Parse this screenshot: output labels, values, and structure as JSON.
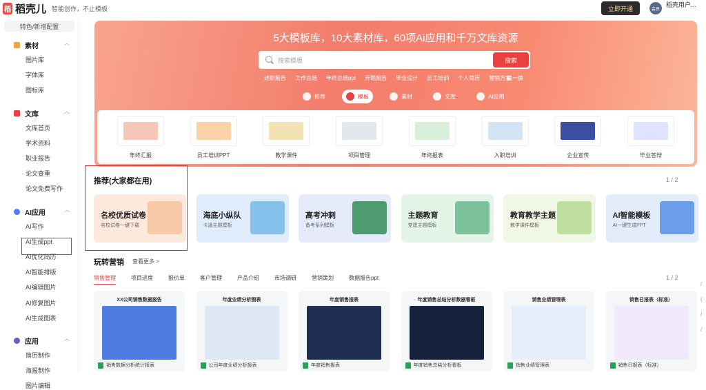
{
  "header": {
    "logo_glyph": "稻",
    "logo_text": "稻壳儿",
    "tagline": "智能创作，不止模板",
    "member_btn": "立即开通",
    "avatar_text": "会员",
    "username": "稻壳用户...",
    "user_sub": ""
  },
  "sidebar": {
    "top_button": "特色/新增配置",
    "groups": [
      {
        "label": "素材",
        "color": "#f0a23b",
        "items": [
          "图片库",
          "字体库",
          "图标库"
        ]
      },
      {
        "label": "文库",
        "color": "#e8413f",
        "items": [
          "文库首页",
          "学术资料",
          "职业报告",
          "论文查重",
          "论文免费写作"
        ]
      },
      {
        "label": "AI应用",
        "color": "#4a7dff",
        "items": [
          "AI写作",
          "AI生成ppt",
          "AI优化简历",
          "AI智能排版",
          "AI编辑图片",
          "AI修复图片",
          "AI生成图表"
        ]
      },
      {
        "label": "应用",
        "color": "#6a5acd",
        "items": [
          "简历制作",
          "海报制作",
          "图片编辑"
        ]
      }
    ]
  },
  "banner": {
    "title": "5大模板库，10大素材库，60项Ai应用和千万文库资源",
    "search_placeholder": "搜索模板",
    "search_button": "搜索",
    "hotwords": [
      "述职报告",
      "工作总结",
      "年终总结ppt",
      "开题报告",
      "毕业设计",
      "员工培训",
      "个人简历",
      "营销方案"
    ],
    "change": "换一换",
    "categories": [
      {
        "label": "推荐",
        "active": false
      },
      {
        "label": "模板",
        "active": true
      },
      {
        "label": "素材",
        "active": false
      },
      {
        "label": "文库",
        "active": false
      },
      {
        "label": "AI应用",
        "active": false
      }
    ],
    "templates": [
      {
        "label": "年终汇报",
        "color": "#f6c7b8"
      },
      {
        "label": "员工培训PPT",
        "color": "#f9d2a8"
      },
      {
        "label": "教学课件",
        "color": "#f2e2b4"
      },
      {
        "label": "项目管理",
        "color": "#e3e8ef"
      },
      {
        "label": "年终报表",
        "color": "#d9efd9"
      },
      {
        "label": "入职培训",
        "color": "#d3e4f7"
      },
      {
        "label": "企业宣传",
        "color": "#3b4fa0"
      },
      {
        "label": "毕业答辩",
        "color": "#dfe3ff"
      }
    ]
  },
  "recommend": {
    "title": "推荐(大家都在用)",
    "pager": "1 / 2",
    "cards": [
      {
        "title": "名校优质试卷",
        "sub": "名校试卷一键下载",
        "bg": "#fde9dc",
        "art": "#f7c9a9"
      },
      {
        "title": "海底小纵队",
        "sub": "卡通主题模板",
        "bg": "#e0ecfb",
        "art": "#86c2ec"
      },
      {
        "title": "高考冲刺",
        "sub": "备考系列模板",
        "bg": "#e5ebfb",
        "art": "#4e9b6f"
      },
      {
        "title": "主题教育",
        "sub": "党建主题模板",
        "bg": "#e4f5e8",
        "art": "#7cc29a"
      },
      {
        "title": "教育教学主题",
        "sub": "教学课件模板",
        "bg": "#f0f7e2",
        "art": "#bedf9f"
      },
      {
        "title": "AI智能模板",
        "sub": "AI一键生成PPT",
        "bg": "#e2ecfb",
        "art": "#6b9ee9"
      }
    ]
  },
  "marketing": {
    "title": "玩转营销",
    "more": "查看更多 >",
    "pager": "1 / 2",
    "tabs": [
      {
        "label": "销售管理",
        "active": true
      },
      {
        "label": "项目进度",
        "active": false
      },
      {
        "label": "报价单",
        "active": false
      },
      {
        "label": "客户管理",
        "active": false
      },
      {
        "label": "产品介绍",
        "active": false
      },
      {
        "label": "市场调研",
        "active": false
      },
      {
        "label": "营销策划",
        "active": false
      },
      {
        "label": "数据报告ppt",
        "active": false
      }
    ],
    "cards": [
      {
        "title": "XX公司销售数据报告",
        "footer": "销售数据分析统计报表",
        "shot": "#4d7de0"
      },
      {
        "title": "年度业绩分析图表",
        "footer": "公司年度业绩分析报表",
        "shot": "#dfe8f6"
      },
      {
        "title": "年度销售报表",
        "footer": "年度销售报表",
        "shot": "#1f2f52"
      },
      {
        "title": "年度销售总结分析数据看板",
        "footer": "年度销售总结分析看板",
        "shot": "#15223d"
      },
      {
        "title": "销售业绩管理表",
        "footer": "销售业绩管理表",
        "shot": "#e7eefb"
      },
      {
        "title": "销售日报表（标准）",
        "footer": "销售日报表（标准）",
        "shot": "#f0e8fb"
      }
    ]
  },
  "right_edge": [
    "/",
    "(",
    "/",
    "/"
  ]
}
